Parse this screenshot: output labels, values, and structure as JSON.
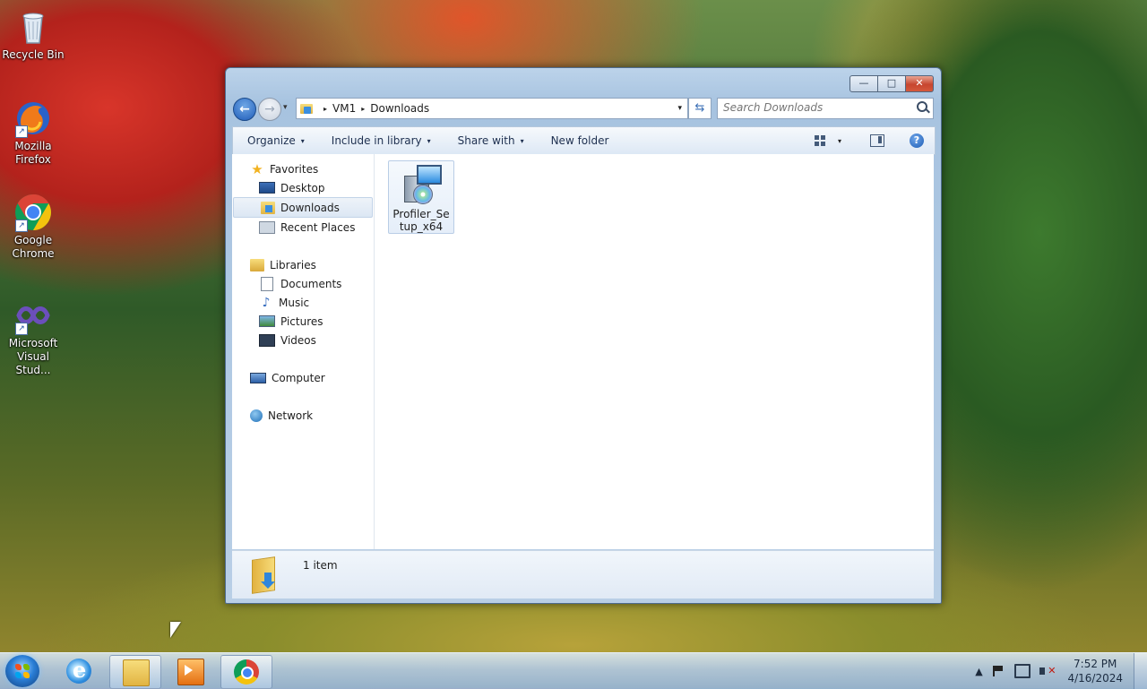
{
  "desktop": {
    "icons": [
      {
        "label": "Recycle Bin",
        "icon": "recycle-bin-icon"
      },
      {
        "label": "Mozilla Firefox",
        "icon": "firefox-icon"
      },
      {
        "label": "Google Chrome",
        "icon": "chrome-icon"
      },
      {
        "label": "Microsoft Visual Stud...",
        "icon": "visual-studio-icon"
      }
    ]
  },
  "window": {
    "caption_buttons": {
      "minimize": "—",
      "maximize": "□",
      "close": "✕"
    },
    "address": {
      "breadcrumbs": [
        "VM1",
        "Downloads"
      ],
      "separator": "▸",
      "dropdown": "▾"
    },
    "search": {
      "placeholder": "Search Downloads"
    },
    "toolbar": {
      "organize": "Organize",
      "include_in_library": "Include in library",
      "share_with": "Share with",
      "new_folder": "New folder",
      "arrow": "▾"
    },
    "navigation": {
      "favorites": {
        "label": "Favorites",
        "items": [
          "Desktop",
          "Downloads",
          "Recent Places"
        ]
      },
      "libraries": {
        "label": "Libraries",
        "items": [
          "Documents",
          "Music",
          "Pictures",
          "Videos"
        ]
      },
      "computer": "Computer",
      "network": "Network",
      "selected": "Downloads"
    },
    "files": [
      {
        "name": "Profiler_Setup_x64",
        "icon": "installer-icon"
      }
    ],
    "status": {
      "count": "1 item"
    }
  },
  "taskbar": {
    "pinned": [
      "internet-explorer-icon",
      "windows-explorer-icon",
      "media-player-icon",
      "chrome-icon"
    ],
    "tray": {
      "expand": "▲"
    },
    "clock": {
      "time": "7:52 PM",
      "date": "4/16/2024"
    }
  },
  "colors": {
    "accent": "#3a8ee0",
    "window_frame": "#a7c3e0",
    "selection": "#dce7f4"
  }
}
